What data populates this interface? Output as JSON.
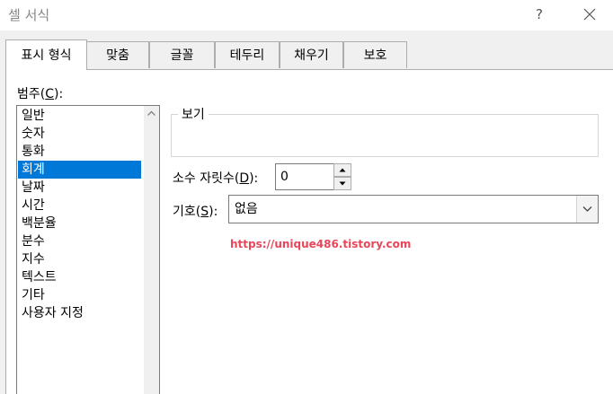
{
  "window": {
    "title": "셀 서식",
    "help_label": "?"
  },
  "tabs": [
    {
      "label": "표시 형식",
      "active": true
    },
    {
      "label": "맞춤"
    },
    {
      "label": "글꼴"
    },
    {
      "label": "테두리"
    },
    {
      "label": "채우기"
    },
    {
      "label": "보호"
    }
  ],
  "category": {
    "label_prefix": "범주(",
    "label_key": "C",
    "label_suffix": "):",
    "items": [
      "일반",
      "숫자",
      "통화",
      "회계",
      "날짜",
      "시간",
      "백분율",
      "분수",
      "지수",
      "텍스트",
      "기타",
      "사용자 지정"
    ],
    "selected_index": 3
  },
  "preview": {
    "label": "보기",
    "value": ""
  },
  "decimals": {
    "label_prefix": "소수 자릿수(",
    "label_key": "D",
    "label_suffix": "):",
    "value": "0"
  },
  "symbol": {
    "label_prefix": "기호(",
    "label_key": "S",
    "label_suffix": "):",
    "value": "없음"
  },
  "watermark": "https://unique486.tistory.com",
  "colors": {
    "selection": "#0078d7",
    "watermark": "#e8465a"
  },
  "icons": {
    "close": "close-icon",
    "scroll_up": "chevron-up-icon",
    "spin_up": "triangle-up-icon",
    "spin_down": "triangle-down-icon",
    "dropdown": "chevron-down-icon"
  }
}
